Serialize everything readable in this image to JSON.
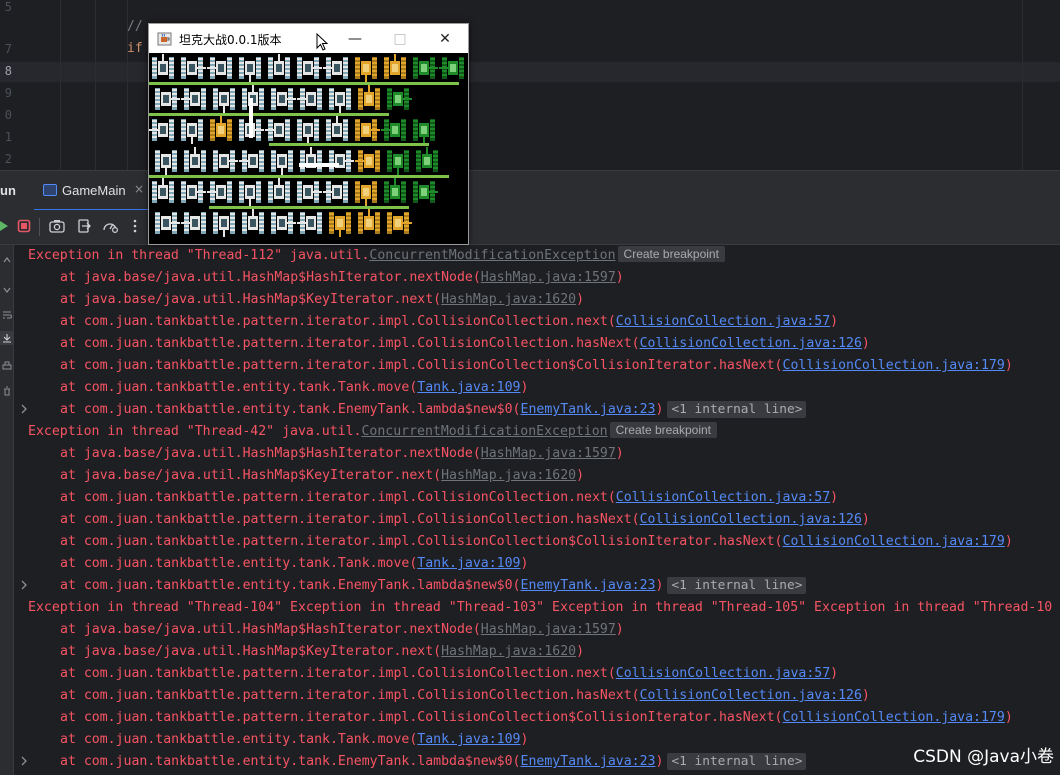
{
  "editor": {
    "line_numbers": [
      "5",
      "7",
      "8",
      "9",
      "0",
      "1",
      "2"
    ],
    "comment_text": "// ",
    "if_text": "if"
  },
  "run_window": {
    "panel_label": "un",
    "tab_label": "GameMain",
    "tab_close": "×"
  },
  "game_window": {
    "title": "坦克大战0.0.1版本",
    "minimize": "—",
    "maximize": "□",
    "close": "✕"
  },
  "colors": {
    "error_text": "#f75464",
    "link": "#548af7",
    "chip_bg": "#393b40"
  },
  "icons": [
    "rerun-icon",
    "stop-icon",
    "camera-icon",
    "exit-icon",
    "profiler-icon",
    "more-icon"
  ],
  "console": {
    "lines": [
      {
        "kind": "exception",
        "prefix": "Exception in thread \"Thread-112\" java.util.",
        "class_link": "ConcurrentModificationException",
        "chip": "Create breakpoint"
      },
      {
        "kind": "frame",
        "text": "at java.base/java.util.HashMap$HashIterator.nextNode(",
        "link": "HashMap.java:1597",
        "link_style": "gray",
        "suffix": ")"
      },
      {
        "kind": "frame",
        "text": "at java.base/java.util.HashMap$KeyIterator.next(",
        "link": "HashMap.java:1620",
        "link_style": "gray",
        "suffix": ")"
      },
      {
        "kind": "frame",
        "text": "at com.juan.tankbattle.pattern.iterator.impl.CollisionCollection.next(",
        "link": "CollisionCollection.java:57",
        "link_style": "blue",
        "suffix": ")"
      },
      {
        "kind": "frame",
        "text": "at com.juan.tankbattle.pattern.iterator.impl.CollisionCollection.hasNext(",
        "link": "CollisionCollection.java:126",
        "link_style": "blue",
        "suffix": ")"
      },
      {
        "kind": "frame",
        "text": "at com.juan.tankbattle.pattern.iterator.impl.CollisionCollection$CollisionIterator.hasNext(",
        "link": "CollisionCollection.java:179",
        "link_style": "blue",
        "suffix": ")"
      },
      {
        "kind": "frame",
        "text": "at com.juan.tankbattle.entity.tank.Tank.move(",
        "link": "Tank.java:109",
        "link_style": "blue",
        "suffix": ")"
      },
      {
        "kind": "frame-fold",
        "text": "at com.juan.tankbattle.entity.tank.EnemyTank.lambda$new$0(",
        "link": "EnemyTank.java:23",
        "link_style": "blue",
        "suffix": ")",
        "chip": "<1 internal line>"
      },
      {
        "kind": "exception",
        "prefix": "Exception in thread \"Thread-42\" java.util.",
        "class_link": "ConcurrentModificationException",
        "chip": "Create breakpoint"
      },
      {
        "kind": "frame",
        "text": "at java.base/java.util.HashMap$HashIterator.nextNode(",
        "link": "HashMap.java:1597",
        "link_style": "gray",
        "suffix": ")"
      },
      {
        "kind": "frame",
        "text": "at java.base/java.util.HashMap$KeyIterator.next(",
        "link": "HashMap.java:1620",
        "link_style": "gray",
        "suffix": ")"
      },
      {
        "kind": "frame",
        "text": "at com.juan.tankbattle.pattern.iterator.impl.CollisionCollection.next(",
        "link": "CollisionCollection.java:57",
        "link_style": "blue",
        "suffix": ")"
      },
      {
        "kind": "frame",
        "text": "at com.juan.tankbattle.pattern.iterator.impl.CollisionCollection.hasNext(",
        "link": "CollisionCollection.java:126",
        "link_style": "blue",
        "suffix": ")"
      },
      {
        "kind": "frame",
        "text": "at com.juan.tankbattle.pattern.iterator.impl.CollisionCollection$CollisionIterator.hasNext(",
        "link": "CollisionCollection.java:179",
        "link_style": "blue",
        "suffix": ")"
      },
      {
        "kind": "frame",
        "text": "at com.juan.tankbattle.entity.tank.Tank.move(",
        "link": "Tank.java:109",
        "link_style": "blue",
        "suffix": ")"
      },
      {
        "kind": "frame-fold",
        "text": "at com.juan.tankbattle.entity.tank.EnemyTank.lambda$new$0(",
        "link": "EnemyTank.java:23",
        "link_style": "blue",
        "suffix": ")",
        "chip": "<1 internal line>"
      },
      {
        "kind": "plain",
        "text": "Exception in thread \"Thread-104\" Exception in thread \"Thread-103\" Exception in thread \"Thread-105\" Exception in thread \"Thread-10"
      },
      {
        "kind": "frame",
        "text": "at java.base/java.util.HashMap$HashIterator.nextNode(",
        "link": "HashMap.java:1597",
        "link_style": "gray",
        "suffix": ")"
      },
      {
        "kind": "frame",
        "text": "at java.base/java.util.HashMap$KeyIterator.next(",
        "link": "HashMap.java:1620",
        "link_style": "gray",
        "suffix": ")"
      },
      {
        "kind": "frame",
        "text": "at com.juan.tankbattle.pattern.iterator.impl.CollisionCollection.next(",
        "link": "CollisionCollection.java:57",
        "link_style": "blue",
        "suffix": ")"
      },
      {
        "kind": "frame",
        "text": "at com.juan.tankbattle.pattern.iterator.impl.CollisionCollection.hasNext(",
        "link": "CollisionCollection.java:126",
        "link_style": "blue",
        "suffix": ")"
      },
      {
        "kind": "frame",
        "text": "at com.juan.tankbattle.pattern.iterator.impl.CollisionCollection$CollisionIterator.hasNext(",
        "link": "CollisionCollection.java:179",
        "link_style": "blue",
        "suffix": ")"
      },
      {
        "kind": "frame",
        "text": "at com.juan.tankbattle.entity.tank.Tank.move(",
        "link": "Tank.java:109",
        "link_style": "blue",
        "suffix": ")"
      },
      {
        "kind": "frame-fold",
        "text": "at com.juan.tankbattle.entity.tank.EnemyTank.lambda$new$0(",
        "link": "EnemyTank.java:23",
        "link_style": "blue",
        "suffix": ")",
        "chip": "<1 internal line>"
      }
    ]
  },
  "watermark": "CSDN @Java小卷"
}
